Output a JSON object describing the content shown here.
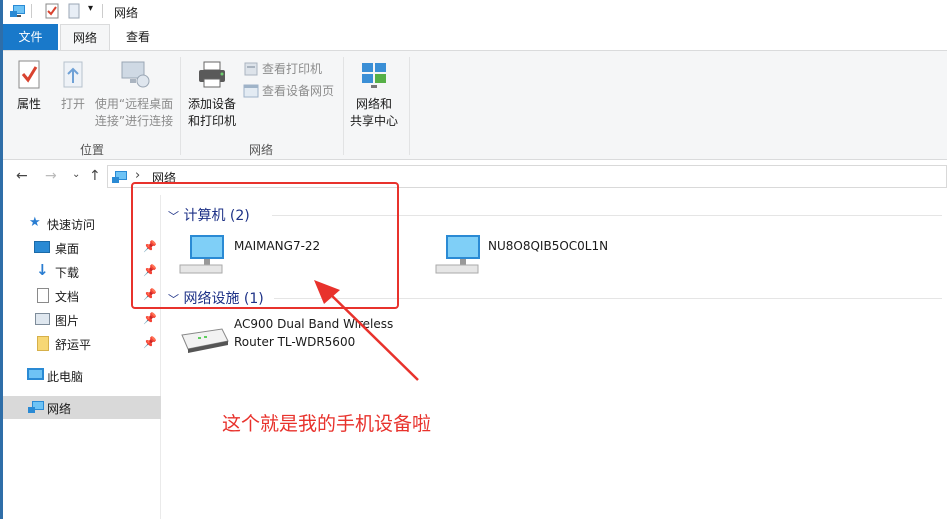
{
  "window": {
    "title": "网络"
  },
  "tabs": {
    "file": "文件",
    "network": "网络",
    "view": "查看"
  },
  "ribbon": {
    "properties": "属性",
    "open": "打开",
    "remote_line1": "使用“远程桌面",
    "remote_line2": "连接”进行连接",
    "group_location": "位置",
    "add_device_line1": "添加设备",
    "add_device_line2": "和打印机",
    "view_printers": "查看打印机",
    "view_device_page": "查看设备网页",
    "group_network": "网络",
    "network_center_line1": "网络和",
    "network_center_line2": "共享中心"
  },
  "address": {
    "path": "网络",
    "separator": "›"
  },
  "navpane": {
    "quick_access": "快速访问",
    "items": [
      "桌面",
      "下载",
      "文档",
      "图片",
      "舒运平"
    ],
    "this_pc": "此电脑",
    "network": "网络"
  },
  "content": {
    "group_computers": "计算机 (2)",
    "group_infra": "网络设施 (1)",
    "computer1": "MAIMANG7-22",
    "computer2": "NU8O8QIB5OC0L1N",
    "router_line1": "AC900 Dual Band Wireless",
    "router_line2": "Router TL-WDR5600"
  },
  "annotation": {
    "note": "这个就是我的手机设备啦",
    "color": "#e8322c"
  }
}
